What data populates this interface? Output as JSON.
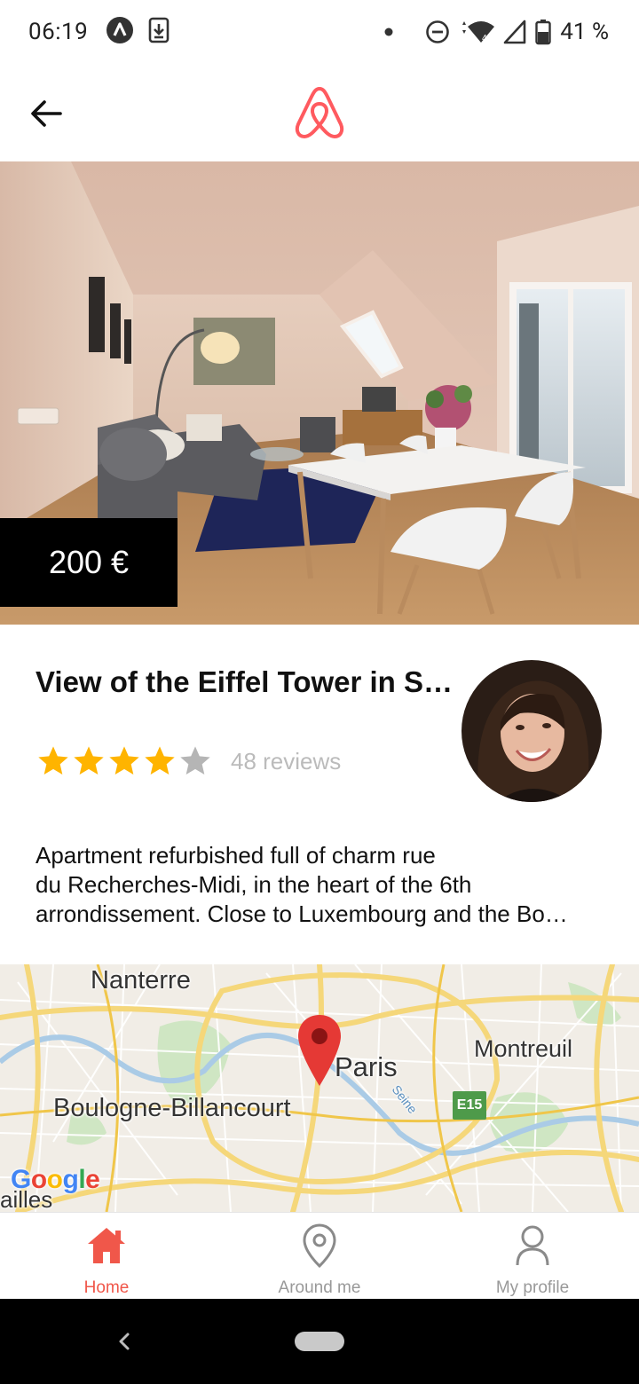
{
  "status_bar": {
    "time": "06:19",
    "battery_percent": "41 %",
    "icons": [
      "app-a-icon",
      "download-icon",
      "dot-icon",
      "do-not-disturb-icon",
      "wifi-icon",
      "signal-icon",
      "battery-icon"
    ]
  },
  "header": {
    "back_icon": "arrow-left-icon",
    "logo": "airbnb-logo-icon",
    "accent_color": "#ff5a5f"
  },
  "listing": {
    "price": "200 €",
    "title": "View of the Eiffel Tower in S…",
    "rating": 4,
    "rating_max": 5,
    "reviews": "48 reviews",
    "description_lines": [
      "Apartment refurbished full of charm rue",
      "du Recherches-Midi, in the heart of the 6th",
      "arrondissement. Close to Luxembourg and the Bo…"
    ],
    "star_color": "#ffb400",
    "star_empty_color": "#b5b5b5"
  },
  "map": {
    "labels": {
      "nanterre": "Nanterre",
      "paris": "Paris",
      "montreuil": "Montreuil",
      "boulogne": "Boulogne-Billancourt",
      "seine": "Seine",
      "bottom": "ailles"
    },
    "road_badge": "E15",
    "attribution": "Google",
    "pin_color": "#e53935"
  },
  "bottom_nav": {
    "items": [
      {
        "label": "Home",
        "icon": "home-icon",
        "active": true
      },
      {
        "label": "Around me",
        "icon": "location-pin-icon",
        "active": false
      },
      {
        "label": "My profile",
        "icon": "user-icon",
        "active": false
      }
    ],
    "active_color": "#f0574a"
  }
}
